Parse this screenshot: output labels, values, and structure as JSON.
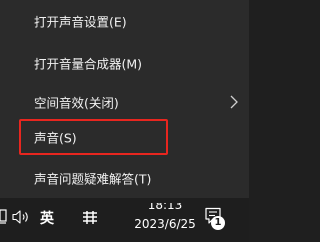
{
  "context_menu": {
    "items": [
      {
        "label": "打开声音设置(E)"
      },
      {
        "label": "打开音量合成器(M)"
      },
      {
        "label": "空间音效(关闭)",
        "has_submenu": true
      },
      {
        "label": "声音(S)",
        "highlighted": true
      },
      {
        "label": "声音问题疑难解答(T)"
      }
    ],
    "highlight_color": "#e8261f"
  },
  "taskbar": {
    "icons": [
      "monitor-icon",
      "speaker-icon",
      "ime-layout-icon",
      "notification-icon"
    ],
    "ime_language": "英",
    "clock": {
      "time": "18:13",
      "date": "2023/6/25"
    },
    "notification_count": "1"
  }
}
